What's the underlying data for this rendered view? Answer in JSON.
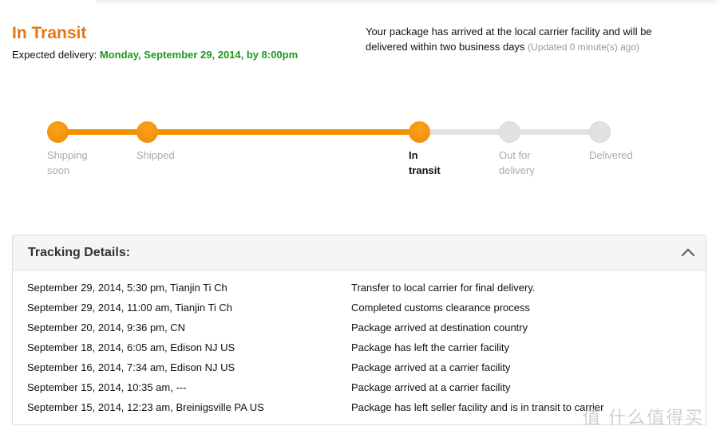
{
  "status": {
    "title": "In Transit",
    "expected_label": "Expected delivery:",
    "expected_date": "Monday, September 29, 2014, by 8:00pm",
    "message": "Your package has arrived at the local carrier facility and will be delivered within two business days",
    "updated": "(Updated 0 minute(s) ago)"
  },
  "progress": {
    "steps": [
      "Shipping soon",
      "Shipped",
      "In transit",
      "Out for delivery",
      "Delivered"
    ],
    "current_step": "In transit",
    "accent": "#f39200",
    "inactive": "#e2e2e2"
  },
  "tracking": {
    "title": "Tracking Details:",
    "rows": [
      {
        "when": "September 29, 2014, 5:30 pm, Tianjin Ti Ch",
        "event": "Transfer to local carrier for final delivery."
      },
      {
        "when": "September 29, 2014, 11:00 am, Tianjin Ti Ch",
        "event": "Completed customs clearance process"
      },
      {
        "when": "September 20, 2014, 9:36 pm, CN",
        "event": "Package arrived at destination country"
      },
      {
        "when": "September 18, 2014, 6:05 am, Edison NJ US",
        "event": "Package has left the carrier facility"
      },
      {
        "when": "September 16, 2014, 7:34 am, Edison NJ US",
        "event": "Package arrived at a carrier facility"
      },
      {
        "when": "September 15, 2014, 10:35 am, ---",
        "event": "Package arrived at a carrier facility"
      },
      {
        "when": "September 15, 2014, 12:23 am, Breinigsville PA US",
        "event": "Package has left seller facility and is in transit to carrier"
      }
    ]
  },
  "watermark": "值 什么值得买"
}
